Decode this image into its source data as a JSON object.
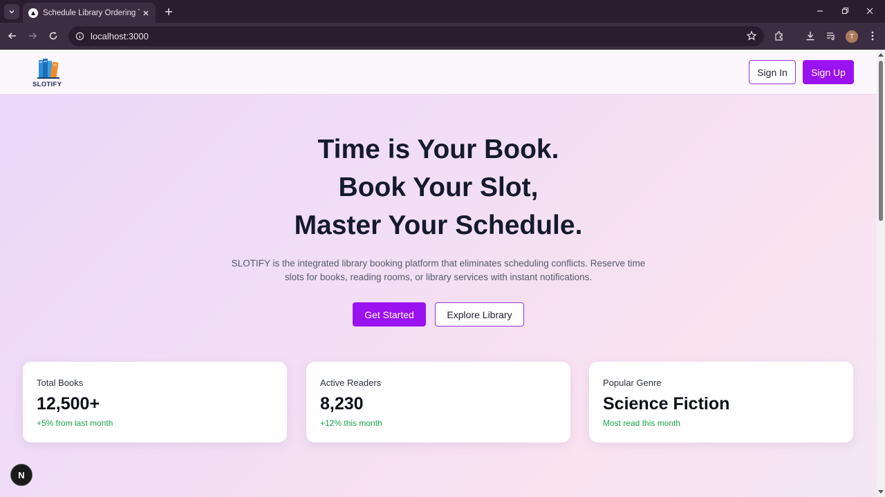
{
  "browser": {
    "tab_title": "Schedule Library Ordering Time",
    "url": "localhost:3000",
    "profile_initial": "T"
  },
  "header": {
    "logo_text": "SLOTIFY",
    "signin_label": "Sign In",
    "signup_label": "Sign Up"
  },
  "hero": {
    "title_line1": "Time is Your Book.",
    "title_line2": "Book Your Slot,",
    "title_line3": "Master Your Schedule.",
    "description": "SLOTIFY is the integrated library booking platform that eliminates scheduling conflicts. Reserve time slots for books, reading rooms, or library services with instant notifications.",
    "get_started_label": "Get Started",
    "explore_label": "Explore Library"
  },
  "stats": [
    {
      "label": "Total Books",
      "value": "12,500+",
      "note": "+5% from last month"
    },
    {
      "label": "Active Readers",
      "value": "8,230",
      "note": "+12% this month"
    },
    {
      "label": "Popular Genre",
      "value": "Science Fiction",
      "note": "Most read this month"
    }
  ],
  "dev_badge": "N",
  "colors": {
    "accent": "#9a12f0",
    "positive": "#1aa64a",
    "chrome_dark": "#2b1d2f",
    "chrome_toolbar": "#3d2d42"
  }
}
